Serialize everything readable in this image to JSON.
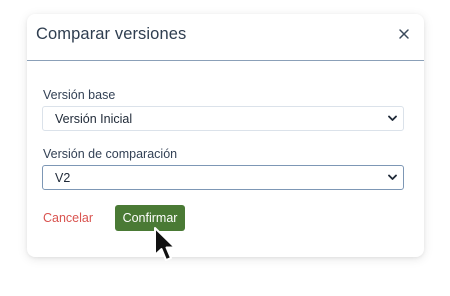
{
  "dialog": {
    "title": "Comparar versiones",
    "close_icon": "close-icon"
  },
  "fields": {
    "base": {
      "label": "Versión base",
      "selected": "Versión Inicial"
    },
    "compare": {
      "label": "Versión de comparación",
      "selected": "V2"
    }
  },
  "actions": {
    "cancel_label": "Cancelar",
    "confirm_label": "Confirmar"
  },
  "colors": {
    "confirm_bg": "#4a7a35",
    "cancel_text": "#d9534f",
    "header_divider": "#8ba0b8"
  }
}
